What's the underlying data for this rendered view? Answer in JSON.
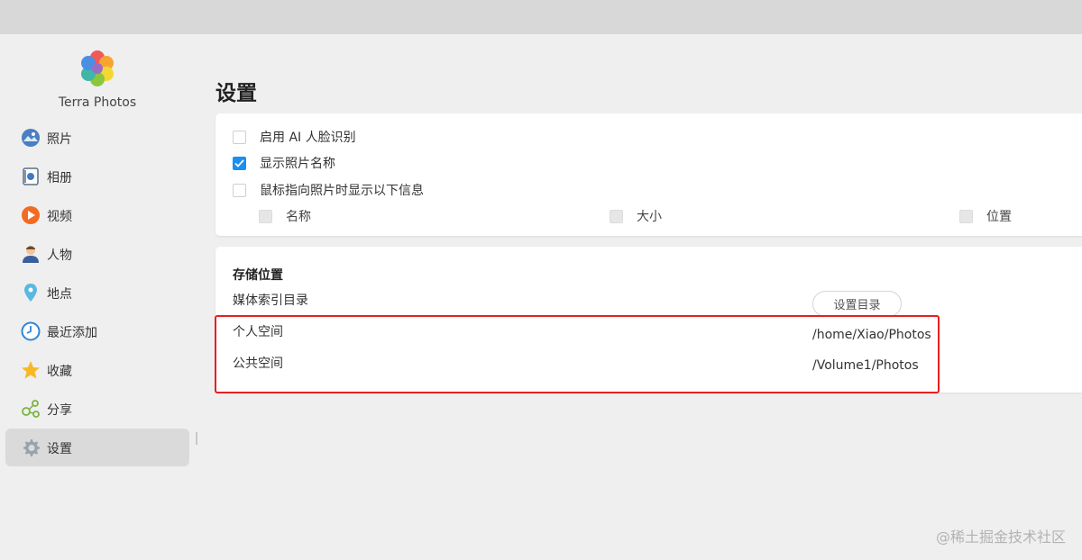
{
  "app": {
    "name": "Terra Photos"
  },
  "sidebar": {
    "items": [
      {
        "label": "照片",
        "icon": "photo-icon"
      },
      {
        "label": "相册",
        "icon": "album-icon"
      },
      {
        "label": "视频",
        "icon": "video-icon"
      },
      {
        "label": "人物",
        "icon": "person-icon"
      },
      {
        "label": "地点",
        "icon": "location-pin-icon"
      },
      {
        "label": "最近添加",
        "icon": "clock-icon"
      },
      {
        "label": "收藏",
        "icon": "star-icon"
      },
      {
        "label": "分享",
        "icon": "share-icon"
      },
      {
        "label": "设置",
        "icon": "gear-icon",
        "active": true
      }
    ]
  },
  "page": {
    "title": "设置"
  },
  "display_settings": {
    "ai_face_recognition": {
      "label": "启用 AI 人脸识别",
      "checked": false
    },
    "show_photo_name": {
      "label": "显示照片名称",
      "checked": true
    },
    "hover_info": {
      "label": "鼠标指向照片时显示以下信息",
      "checked": false
    },
    "hover_options": [
      {
        "label": "名称",
        "checked": false,
        "disabled": true
      },
      {
        "label": "大小",
        "checked": false,
        "disabled": true
      },
      {
        "label": "位置",
        "checked": false,
        "disabled": true
      }
    ]
  },
  "storage": {
    "title": "存储位置",
    "media_index_label": "媒体索引目录",
    "set_dir_button": "设置目录",
    "personal_space": {
      "label": "个人空间",
      "path": "/home/Xiao/Photos"
    },
    "public_space": {
      "label": "公共空间",
      "path": "/Volume1/Photos"
    }
  },
  "colors": {
    "accent": "#1a8ff0",
    "highlight_border": "#e8201f"
  },
  "watermark": "@稀土掘金技术社区"
}
